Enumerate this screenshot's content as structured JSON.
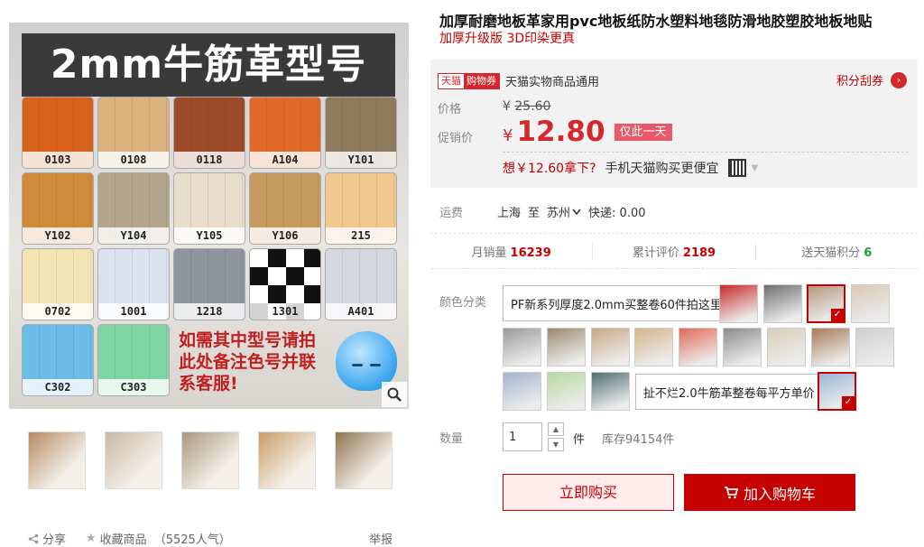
{
  "gallery": {
    "banner": "2mm牛筋革型号",
    "swatches": [
      {
        "code": "0103",
        "color": "#d9621c"
      },
      {
        "code": "0108",
        "color": "#d9b27d"
      },
      {
        "code": "0118",
        "color": "#9c4a2a"
      },
      {
        "code": "A104",
        "color": "#e06a2a"
      },
      {
        "code": "Y101",
        "color": "#8f7a5e"
      },
      {
        "code": "Y102",
        "color": "#d08a3c"
      },
      {
        "code": "Y104",
        "color": "#b3a58c"
      },
      {
        "code": "Y105",
        "color": "#e8dccb"
      },
      {
        "code": "Y106",
        "color": "#c79a60"
      },
      {
        "code": "215",
        "color": "#f1c98e"
      },
      {
        "code": "0702",
        "color": "#f3e4b5"
      },
      {
        "code": "1001",
        "color": "#dce3ef"
      },
      {
        "code": "1218",
        "color": "#8f959e"
      },
      {
        "code": "1301",
        "color": "checker"
      },
      {
        "code": "A401",
        "color": "#d6d8e0"
      },
      {
        "code": "C302",
        "color": "#6bbde8"
      },
      {
        "code": "C303",
        "color": "#7fd6a4"
      }
    ],
    "promo_line1": "如需其中型号请拍",
    "promo_line2": "此处备注色号并联",
    "promo_line3": "系客服!",
    "thumbnails": [
      "#b48a62",
      "#c9b8a4",
      "#a9987e",
      "#c99d6a",
      "#8f7450"
    ]
  },
  "share": {
    "share_label": "分享",
    "collect_label": "收藏商品",
    "popularity": "（5525人气）",
    "report_label": "举报"
  },
  "product": {
    "title": "加厚耐磨地板革家用pvc地板纸防水塑料地毯防滑地胶塑胶地板地贴",
    "subtitle": "加厚升级版 3D印染更真"
  },
  "price": {
    "coupon_a": "天猫",
    "coupon_b": "购物券",
    "coupon_text": "天猫实物商品通用",
    "points_label": "积分刮券",
    "orig_label": "价格",
    "orig_currency": "¥",
    "orig_value": "25.60",
    "sale_label": "促销价",
    "sale_currency": "¥",
    "sale_value": "12.80",
    "sale_tag": "仅此一天",
    "mobile_offer": "想￥12.60拿下?",
    "mobile_cta": "手机天猫购买更便宜"
  },
  "shipping": {
    "label": "运费",
    "from": "上海",
    "to_word": "至",
    "to": "苏州",
    "express": "快递: 0.00"
  },
  "stats": {
    "monthly_label": "月销量",
    "monthly_value": "16239",
    "reviews_label": "累计评价",
    "reviews_value": "2189",
    "points_label": "送天猫积分",
    "points_value": "6"
  },
  "options": {
    "label": "颜色分类",
    "text_option_1": "PF新系列厚度2.0mm买整卷60件拍这里",
    "text_option_2": "扯不烂2.0牛筋革整卷每平方单价",
    "image_colors_row1": [
      "#c82b2b",
      "#6e6e6e",
      "#b69882",
      "#d9c7b5"
    ],
    "image_colors_row2": [
      "#9a9a9a",
      "#9c8a72",
      "#c9a885",
      "#d6b48b",
      "#e26b57",
      "#8c8c8c",
      "#d8cdb9",
      "#a57c58",
      "#cfcfcf"
    ],
    "image_colors_row3": [
      "#a5b4cf",
      "#b8d9a0",
      "#4f6f72"
    ]
  },
  "quantity": {
    "label": "数量",
    "value": "1",
    "unit": "件",
    "stock": "库存94154件"
  },
  "actions": {
    "buy_now": "立即购买",
    "add_cart": "加入购物车"
  }
}
